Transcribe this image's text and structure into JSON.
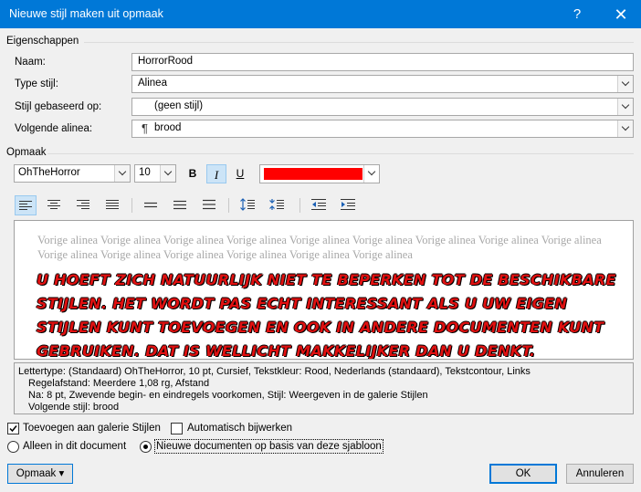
{
  "window": {
    "title": "Nieuwe stijl maken uit opmaak",
    "help_label": "?",
    "close_label": "✕"
  },
  "properties": {
    "section_label": "Eigenschappen",
    "name_label": "Naam:",
    "name_value": "HorrorRood",
    "type_label": "Type stijl:",
    "type_value": "Alinea",
    "based_on_label": "Stijl gebaseerd op:",
    "based_on_value": "(geen stijl)",
    "following_label": "Volgende alinea:",
    "following_value": "brood",
    "following_icon": "pilcrow-icon"
  },
  "formatting": {
    "section_label": "Opmaak",
    "font_value": "OhTheHorror",
    "size_value": "10",
    "bold_label": "B",
    "italic_label": "I",
    "underline_label": "U",
    "italic_active": true,
    "font_color": "#ff0000",
    "alignment_active": "align-left"
  },
  "preview": {
    "previous_paragraph": "Vorige alinea Vorige alinea Vorige alinea Vorige alinea Vorige alinea Vorige alinea Vorige alinea Vorige alinea Vorige alinea Vorige alinea Vorige alinea Vorige alinea Vorige alinea Vorige alinea Vorige alinea",
    "sample_text": "U hoeft zich natuurlijk niet te beperken tot de beschikbare stijlen. Het wordt pas echt interessant als u uw eigen stijlen kunt toevoegen en ook in andere documenten kunt gebruiken. Dat is wellicht makkelijker dan u denkt."
  },
  "description": {
    "line1": "Lettertype: (Standaard) OhTheHorror, 10 pt, Cursief, Tekstkleur: Rood, Nederlands (standaard), Tekstcontour, Links",
    "line2": "Regelafstand:  Meerdere 1,08 rg, Afstand",
    "line3": "Na:  8 pt, Zwevende begin- en eindregels voorkomen, Stijl: Weergeven in de galerie Stijlen",
    "line4": "Volgende stijl: brood"
  },
  "options": {
    "add_to_gallery_label": "Toevoegen aan galerie Stijlen",
    "add_to_gallery_checked": true,
    "auto_update_label": "Automatisch bijwerken",
    "auto_update_checked": false,
    "only_this_doc_label": "Alleen in dit document",
    "new_docs_label": "Nieuwe documenten op basis van deze sjabloon",
    "selected_scope": "new_docs"
  },
  "buttons": {
    "format_label": "Opmaak ▾",
    "ok_label": "OK",
    "cancel_label": "Annuleren"
  }
}
